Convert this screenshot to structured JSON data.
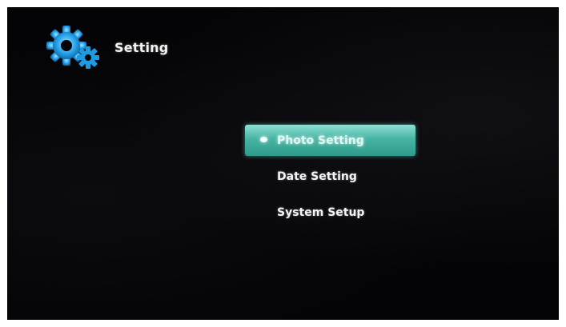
{
  "header": {
    "title": "Setting",
    "icon": "gears-icon"
  },
  "menu": {
    "items": [
      {
        "label": "Photo Setting",
        "selected": true
      },
      {
        "label": "Date Setting",
        "selected": false
      },
      {
        "label": "System Setup",
        "selected": false
      }
    ]
  },
  "colors": {
    "background": "#040406",
    "highlight": "#47b4a3",
    "gear": "#1e9be0",
    "text": "#f4f4f4"
  }
}
